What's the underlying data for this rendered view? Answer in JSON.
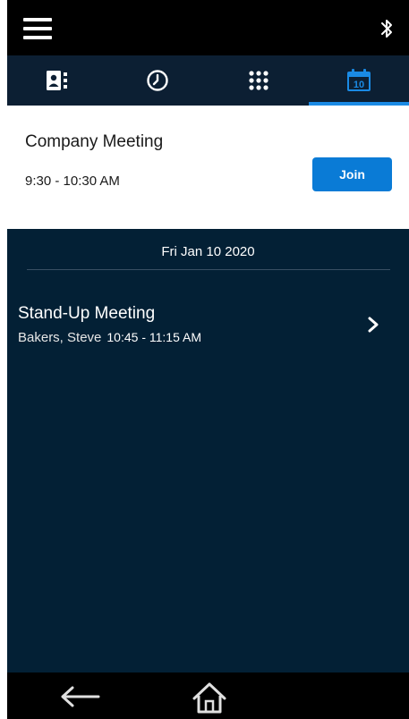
{
  "status_bar": {
    "menu_icon": "hamburger-menu-icon",
    "bluetooth_icon": "bluetooth-icon"
  },
  "tabs": [
    {
      "icon": "contacts-icon",
      "active": false
    },
    {
      "icon": "recents-clock-icon",
      "active": false
    },
    {
      "icon": "dialpad-icon",
      "active": false
    },
    {
      "icon": "calendar-icon",
      "active": true,
      "calendar_day": "10"
    }
  ],
  "current_meeting": {
    "title": "Company Meeting",
    "time": "9:30 - 10:30 AM",
    "join_label": "Join"
  },
  "schedule": {
    "date": "Fri Jan 10 2020",
    "meetings": [
      {
        "title": "Stand-Up Meeting",
        "organizer": "Bakers, Steve",
        "time": "10:45 - 11:15 AM"
      }
    ]
  },
  "nav": {
    "back_icon": "back-arrow-icon",
    "home_icon": "home-icon"
  },
  "colors": {
    "accent": "#0a7bd6",
    "tab_bar": "#0c1f33",
    "schedule_bg": "#032035",
    "status_bar": "#000000"
  }
}
